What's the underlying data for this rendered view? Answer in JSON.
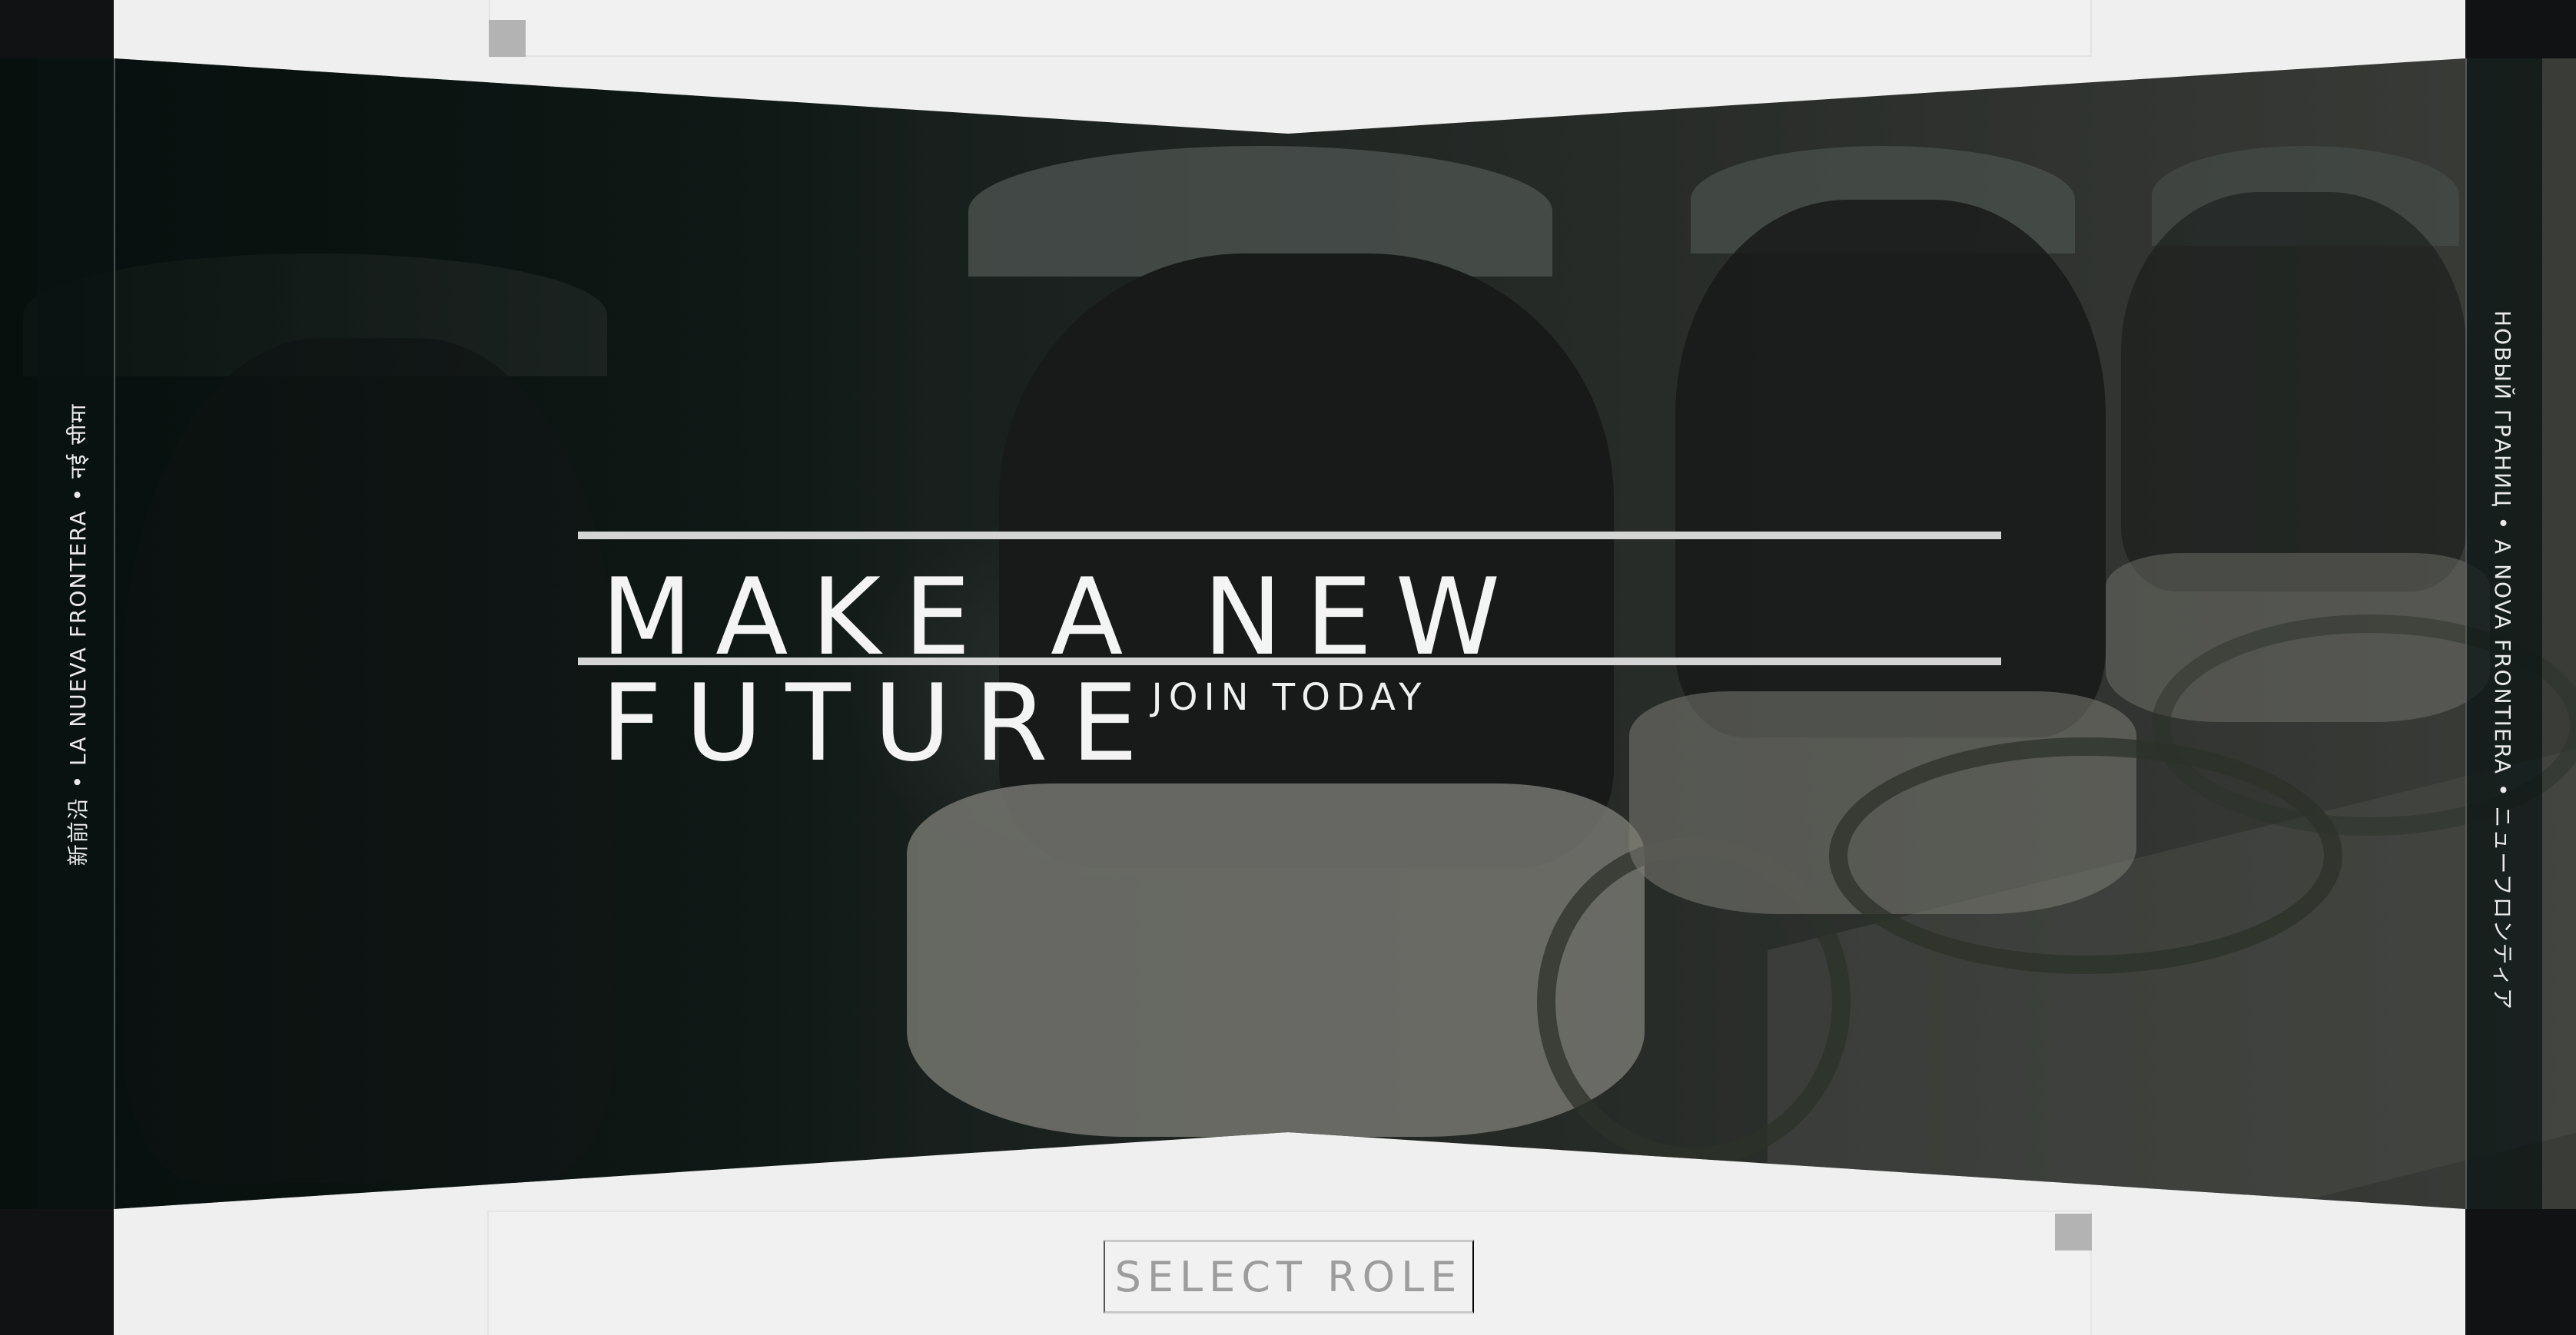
{
  "hero": {
    "headline": "MAKE A NEW FUTURE",
    "subline": "JOIN TODAY",
    "left_vertical_text": "新前沿 • LA NUEVA FRONTERA • नई सीमा",
    "right_vertical_text": "НОВЫЙ ГРАНИЦ • A NOVA FRONTIERA • ニューフロンティア",
    "background_image": "row of vintage space helmets"
  },
  "actions": {
    "select_role_label": "SELECT ROLE"
  },
  "colors": {
    "page_background": "#efefef",
    "side_columns": "#101214",
    "headline_text": "#f4f4f4",
    "rule": "#d4d4d4",
    "button_text": "#9d9d9d",
    "marker": "#b3b3b3"
  }
}
